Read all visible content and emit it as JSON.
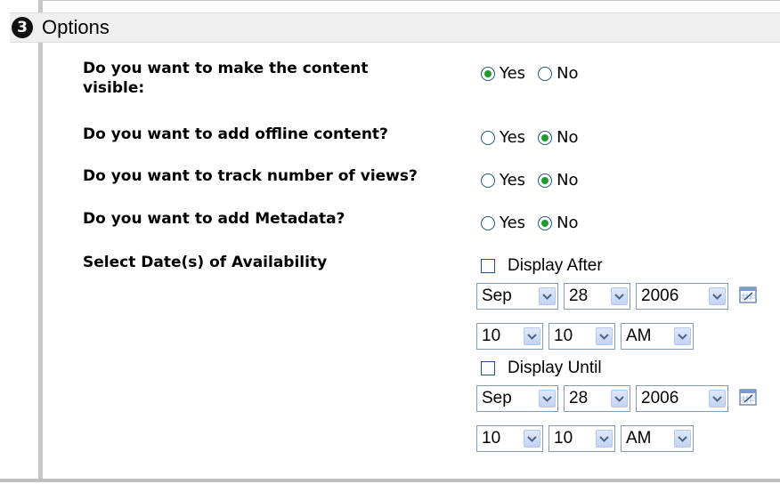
{
  "section": {
    "step_number": "3",
    "title": "Options"
  },
  "questions": [
    {
      "line1": "Do you want to make the content",
      "line2": "visible:",
      "options": [
        {
          "label": "Yes",
          "checked": true
        },
        {
          "label": "No",
          "checked": false
        }
      ]
    },
    {
      "line1": "Do you want to add offline content?",
      "options": [
        {
          "label": "Yes",
          "checked": false
        },
        {
          "label": "No",
          "checked": true
        }
      ]
    },
    {
      "line1": "Do you want to track number of views?",
      "options": [
        {
          "label": "Yes",
          "checked": false
        },
        {
          "label": "No",
          "checked": true
        }
      ]
    },
    {
      "line1": "Do you want to add Metadata?",
      "options": [
        {
          "label": "Yes",
          "checked": false
        },
        {
          "label": "No",
          "checked": true
        }
      ]
    }
  ],
  "availability": {
    "label": "Select Date(s) of Availability",
    "display_after": {
      "label": "Display After",
      "checked": false,
      "month": "Sep",
      "day": "28",
      "year": "2006",
      "hour": "10",
      "minute": "10",
      "ampm": "AM"
    },
    "display_until": {
      "label": "Display Until",
      "checked": false,
      "month": "Sep",
      "day": "28",
      "year": "2006",
      "hour": "10",
      "minute": "10",
      "ampm": "AM"
    }
  },
  "icons": {
    "step_badge": "circled-number-icon",
    "dropdown": "chevron-down-icon",
    "calendar": "calendar-icon"
  },
  "colors": {
    "radio_dot": "#1f9a2b",
    "control_border": "#1c5180",
    "select_border": "#7f9db9",
    "header_bg": "#efefef"
  }
}
